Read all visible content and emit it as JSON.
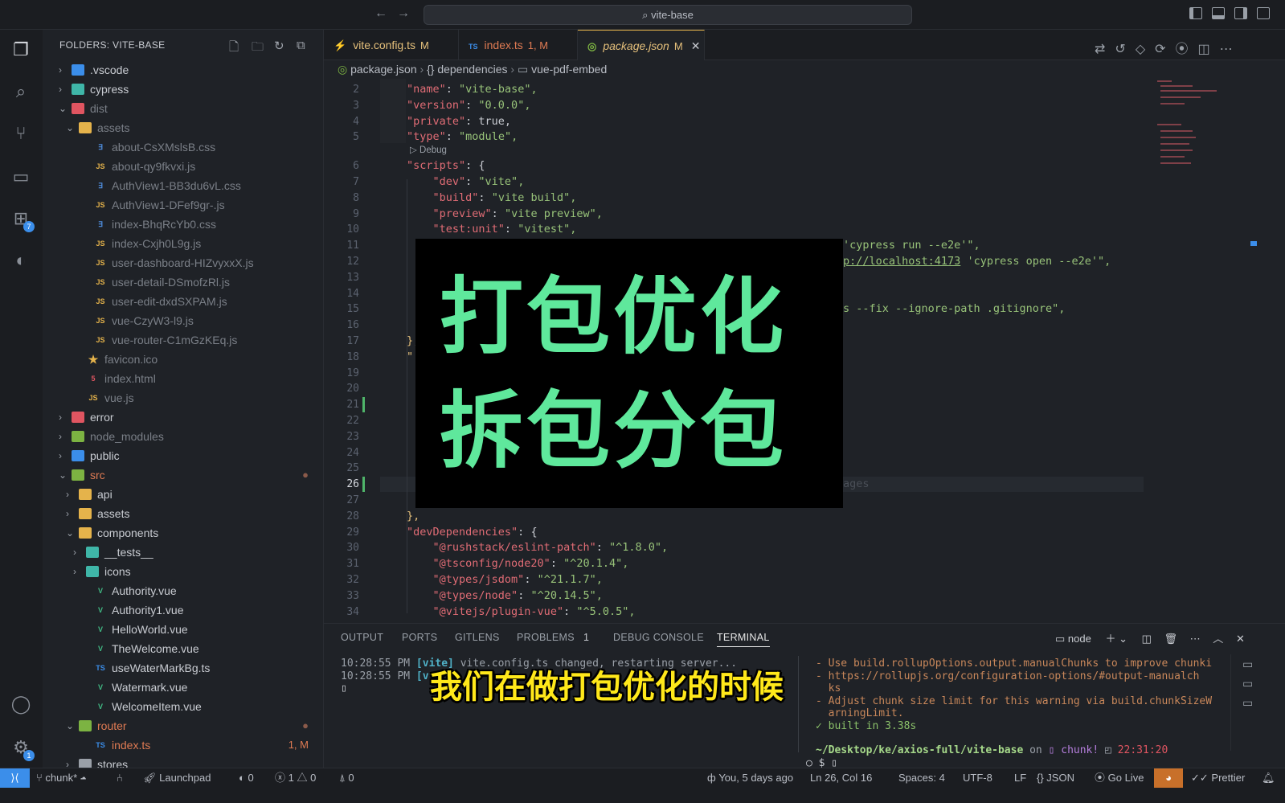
{
  "window": {
    "search": "vite-base"
  },
  "activity": {
    "extensions_badge": "7",
    "settings_badge": "1"
  },
  "sidebar": {
    "title": "FOLDERS: VITE-BASE",
    "items": [
      {
        "depth": 0,
        "type": "folder",
        "open": false,
        "label": ".vscode",
        "color": "#c9ccd2",
        "icon": "#3b8eea"
      },
      {
        "depth": 0,
        "type": "folder",
        "open": false,
        "label": "cypress",
        "color": "#c9ccd2",
        "icon": "#3fb6a8"
      },
      {
        "depth": 0,
        "type": "folder",
        "open": true,
        "label": "dist",
        "color": "#7a7f87",
        "icon": "#e05561"
      },
      {
        "depth": 1,
        "type": "folder",
        "open": true,
        "label": "assets",
        "color": "#7a7f87",
        "icon": "#e5b34b"
      },
      {
        "depth": 2,
        "type": "css",
        "label": "about-CsXMslsB.css",
        "color": "#7a7f87"
      },
      {
        "depth": 2,
        "type": "js",
        "label": "about-qy9fkvxi.js",
        "color": "#7a7f87"
      },
      {
        "depth": 2,
        "type": "css",
        "label": "AuthView1-BB3du6vL.css",
        "color": "#7a7f87"
      },
      {
        "depth": 2,
        "type": "js",
        "label": "AuthView1-DFef9gr-.js",
        "color": "#7a7f87"
      },
      {
        "depth": 2,
        "type": "css",
        "label": "index-BhqRcYb0.css",
        "color": "#7a7f87"
      },
      {
        "depth": 2,
        "type": "js",
        "label": "index-Cxjh0L9g.js",
        "color": "#7a7f87"
      },
      {
        "depth": 2,
        "type": "js",
        "label": "user-dashboard-HIZvyxxX.js",
        "color": "#7a7f87"
      },
      {
        "depth": 2,
        "type": "js",
        "label": "user-detail-DSmofzRl.js",
        "color": "#7a7f87"
      },
      {
        "depth": 2,
        "type": "js",
        "label": "user-edit-dxdSXPAM.js",
        "color": "#7a7f87"
      },
      {
        "depth": 2,
        "type": "js",
        "label": "vue-CzyW3-l9.js",
        "color": "#7a7f87"
      },
      {
        "depth": 2,
        "type": "js",
        "label": "vue-router-C1mGzKEq.js",
        "color": "#7a7f87"
      },
      {
        "depth": 1,
        "type": "star",
        "label": "favicon.ico",
        "color": "#7a7f87"
      },
      {
        "depth": 1,
        "type": "html",
        "label": "index.html",
        "color": "#7a7f87"
      },
      {
        "depth": 1,
        "type": "js",
        "label": "vue.js",
        "color": "#7a7f87"
      },
      {
        "depth": 0,
        "type": "folder",
        "open": false,
        "label": "error",
        "color": "#c9ccd2",
        "icon": "#e05561"
      },
      {
        "depth": 0,
        "type": "folder",
        "open": false,
        "label": "node_modules",
        "color": "#7a7f87",
        "icon": "#7cb342"
      },
      {
        "depth": 0,
        "type": "folder",
        "open": false,
        "label": "public",
        "color": "#c9ccd2",
        "icon": "#3b8eea"
      },
      {
        "depth": 0,
        "type": "folder",
        "open": true,
        "label": "src",
        "color": "#e07b53",
        "icon": "#7cb342",
        "status": "●"
      },
      {
        "depth": 1,
        "type": "folder",
        "open": false,
        "label": "api",
        "color": "#c9ccd2",
        "icon": "#e5b34b"
      },
      {
        "depth": 1,
        "type": "folder",
        "open": false,
        "label": "assets",
        "color": "#c9ccd2",
        "icon": "#e5b34b"
      },
      {
        "depth": 1,
        "type": "folder",
        "open": true,
        "label": "components",
        "color": "#c9ccd2",
        "icon": "#e5b34b"
      },
      {
        "depth": 2,
        "type": "folder",
        "open": false,
        "label": "__tests__",
        "color": "#c9ccd2",
        "icon": "#3fb6a8"
      },
      {
        "depth": 2,
        "type": "folder",
        "open": false,
        "label": "icons",
        "color": "#c9ccd2",
        "icon": "#3fb6a8"
      },
      {
        "depth": 2,
        "type": "vue",
        "label": "Authority.vue",
        "color": "#c9ccd2"
      },
      {
        "depth": 2,
        "type": "vue",
        "label": "Authority1.vue",
        "color": "#c9ccd2"
      },
      {
        "depth": 2,
        "type": "vue",
        "label": "HelloWorld.vue",
        "color": "#c9ccd2"
      },
      {
        "depth": 2,
        "type": "vue",
        "label": "TheWelcome.vue",
        "color": "#c9ccd2"
      },
      {
        "depth": 2,
        "type": "ts",
        "label": "useWaterMarkBg.ts",
        "color": "#c9ccd2"
      },
      {
        "depth": 2,
        "type": "vue",
        "label": "Watermark.vue",
        "color": "#c9ccd2"
      },
      {
        "depth": 2,
        "type": "vue",
        "label": "WelcomeItem.vue",
        "color": "#c9ccd2"
      },
      {
        "depth": 1,
        "type": "folder",
        "open": true,
        "label": "router",
        "color": "#e07b53",
        "icon": "#7cb342",
        "status": "●"
      },
      {
        "depth": 2,
        "type": "ts",
        "label": "index.ts",
        "color": "#e07b53",
        "status": "1, M"
      },
      {
        "depth": 1,
        "type": "folder",
        "open": false,
        "label": "stores",
        "color": "#c9ccd2",
        "icon": "#9aa0a8"
      }
    ]
  },
  "tabs": [
    {
      "label": "vite.config.ts",
      "status": "M",
      "icon": "⚡",
      "icon_color": "#e5b34b",
      "label_color": "#e5c07b"
    },
    {
      "label": "index.ts",
      "status": "1, M",
      "icon": "TS",
      "icon_color": "#3b8eea",
      "label_color": "#e07b53"
    },
    {
      "label": "package.json",
      "status": "M",
      "icon": "◎",
      "icon_color": "#7cb342",
      "label_color": "#e5c07b",
      "active": true,
      "close": "✕"
    }
  ],
  "breadcrumb": [
    "package.json",
    "{} dependencies",
    "vue-pdf-embed"
  ],
  "codelens": "Debug",
  "code": [
    {
      "n": 2,
      "i": 1,
      "k": "\"name\"",
      "v": "\"vite-base\","
    },
    {
      "n": 3,
      "i": 1,
      "k": "\"version\"",
      "v": "\"0.0.0\","
    },
    {
      "n": 4,
      "i": 1,
      "k": "\"private\"",
      "v": "true,"
    },
    {
      "n": 5,
      "i": 1,
      "k": "\"type\"",
      "v": "\"module\","
    },
    {
      "n": 6,
      "i": 1,
      "k": "\"scripts\"",
      "v": "{"
    },
    {
      "n": 7,
      "i": 2,
      "k": "\"dev\"",
      "v": "\"vite\","
    },
    {
      "n": 8,
      "i": 2,
      "k": "\"build\"",
      "v": "\"vite build\","
    },
    {
      "n": 9,
      "i": 2,
      "k": "\"preview\"",
      "v": "\"vite preview\","
    },
    {
      "n": 10,
      "i": 2,
      "k": "\"test:unit\"",
      "v": "\"vitest\","
    },
    {
      "n": 11,
      "tail": "'cypress run --e2e'\","
    },
    {
      "n": 12,
      "tail_link": "p://localhost:4173",
      "tail": " 'cypress open --e2e'\","
    },
    {
      "n": 13
    },
    {
      "n": 14
    },
    {
      "n": 15,
      "tail": "s --fix --ignore-path .gitignore\","
    },
    {
      "n": 16
    },
    {
      "n": 17,
      "i": 1,
      "raw": "},"
    },
    {
      "n": 18,
      "i": 1,
      "raw": "\""
    },
    {
      "n": 19
    },
    {
      "n": 20
    },
    {
      "n": 21
    },
    {
      "n": 22
    },
    {
      "n": 23
    },
    {
      "n": 24
    },
    {
      "n": 25
    },
    {
      "n": 26,
      "ghost": "ages"
    },
    {
      "n": 27
    },
    {
      "n": 28,
      "i": 1,
      "raw": "},"
    },
    {
      "n": 29,
      "i": 1,
      "k": "\"devDependencies\"",
      "v": "{"
    },
    {
      "n": 30,
      "i": 2,
      "k": "\"@rushstack/eslint-patch\"",
      "v": "\"^1.8.0\","
    },
    {
      "n": 31,
      "i": 2,
      "k": "\"@tsconfig/node20\"",
      "v": "\"^20.1.4\","
    },
    {
      "n": 32,
      "i": 2,
      "k": "\"@types/jsdom\"",
      "v": "\"^21.1.7\","
    },
    {
      "n": 33,
      "i": 2,
      "k": "\"@types/node\"",
      "v": "\"^20.14.5\","
    },
    {
      "n": 34,
      "i": 2,
      "k": "\"@vitejs/plugin-vue\"",
      "v": "\"^5.0.5\","
    }
  ],
  "current_line": 26,
  "overlay": {
    "line1": "打包优化",
    "line2": "拆包分包",
    "color": "#5fe89c"
  },
  "panel": {
    "tabs": [
      "OUTPUT",
      "PORTS",
      "GITLENS",
      "PROBLEMS",
      "DEBUG CONSOLE",
      "TERMINAL"
    ],
    "problems_count": "1",
    "active": "TERMINAL",
    "terminal_name": "node"
  },
  "terminal_left": [
    {
      "time": "10:28:55 PM",
      "tag": "[vite]",
      "msg": " vite.config.ts changed, restarting server..."
    },
    {
      "time": "10:28:55 PM",
      "tag": "[v",
      "msg": ""
    }
  ],
  "terminal_right": {
    "warn": [
      "- Use build.rollupOptions.output.manualChunks to improve chunki",
      "- https://rollupjs.org/configuration-options/#output-manualch",
      "  ks",
      "- Adjust chunk size limit for this warning via build.chunkSizeW",
      "  arningLimit."
    ],
    "built": "✓ built in 3.38s",
    "path": "~/Desktop/ke/axios-full/vite-base",
    "on": "on",
    "branch": "chunk!",
    "time": "22:31:20",
    "prompt": "$"
  },
  "subtitle": "我们在做打包优化的时候",
  "status": {
    "branch": "chunk*",
    "launchpad": "Launchpad",
    "ports": "0",
    "errors": "1",
    "warnings": "0",
    "broadcast": "0",
    "blame": "You, 5 days ago",
    "position": "Ln 26, Col 16",
    "spaces": "Spaces: 4",
    "encoding": "UTF-8",
    "eol": "LF",
    "language": "JSON",
    "golive": "Go Live",
    "prettier": "Prettier"
  }
}
